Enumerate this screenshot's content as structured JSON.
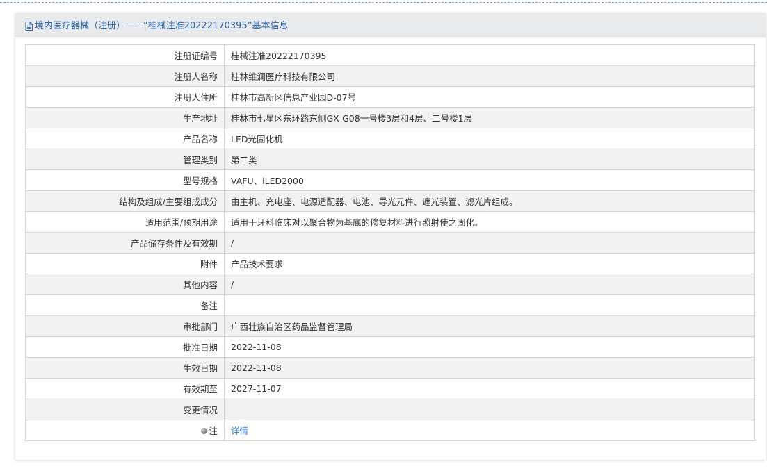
{
  "header": {
    "icon": "document-icon",
    "title": "境内医疗器械（注册）——“桂械注准20222170395”基本信息"
  },
  "rows": [
    {
      "label": "注册证编号",
      "value": "桂械注准20222170395"
    },
    {
      "label": "注册人名称",
      "value": "桂林维润医疗科技有限公司"
    },
    {
      "label": "注册人住所",
      "value": "桂林市高新区信息产业园D-07号"
    },
    {
      "label": "生产地址",
      "value": "桂林市七星区东环路东侧GX-G08一号楼3层和4层、二号楼1层"
    },
    {
      "label": "产品名称",
      "value": "LED光固化机"
    },
    {
      "label": "管理类别",
      "value": "第二类"
    },
    {
      "label": "型号规格",
      "value": "VAFU、iLED2000"
    },
    {
      "label": "结构及组成/主要组成成分",
      "value": "由主机、充电座、电源适配器、电池、导光元件、遮光装置、滤光片组成。"
    },
    {
      "label": "适用范围/预期用途",
      "value": "适用于牙科临床对以聚合物为基底的修复材料进行照射使之固化。"
    },
    {
      "label": "产品储存条件及有效期",
      "value": "/"
    },
    {
      "label": "附件",
      "value": "产品技术要求"
    },
    {
      "label": "其他内容",
      "value": "/"
    },
    {
      "label": "备注",
      "value": ""
    },
    {
      "label": "审批部门",
      "value": "广西壮族自治区药品监督管理局"
    },
    {
      "label": "批准日期",
      "value": "2022-11-08"
    },
    {
      "label": "生效日期",
      "value": "2022-11-08"
    },
    {
      "label": "有效期至",
      "value": "2027-11-07"
    },
    {
      "label": "变更情况",
      "value": ""
    },
    {
      "label": "注",
      "value": "详情"
    }
  ],
  "colors": {
    "title": "#2a63a8",
    "link": "#2a7bd1",
    "header_bg": "#e9eaec",
    "row_alt_bg": "#f2f2f2",
    "border": "#d3d3d3"
  }
}
